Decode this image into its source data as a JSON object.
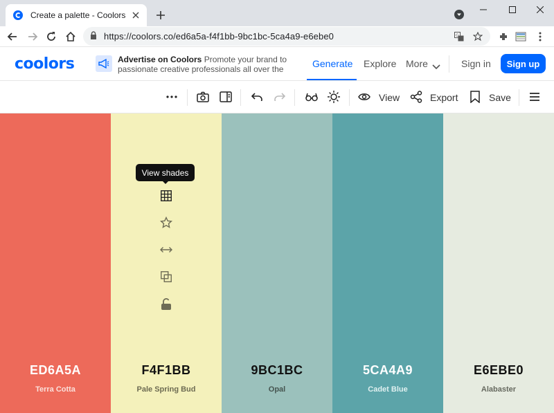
{
  "browser": {
    "tab_title": "Create a palette - Coolors",
    "url_host": "https://coolors.co",
    "url_path": "/ed6a5a-f4f1bb-9bc1bc-5ca4a9-e6ebe0"
  },
  "header": {
    "logo": "coolors",
    "ad_title": "Advertise on Coolors",
    "ad_body": "Promote your brand to passionate creative professionals all over the",
    "nav": [
      "Generate",
      "Explore",
      "More"
    ],
    "signin": "Sign in",
    "signup": "Sign up"
  },
  "toolbar": {
    "view_label": "View",
    "export_label": "Export",
    "save_label": "Save"
  },
  "tooltip": "View shades",
  "colors": [
    {
      "hex": "ED6A5A",
      "name": "Terra Cotta",
      "bg": "#ed6a5a",
      "text": "#ffffff",
      "sub": "#fbe0db"
    },
    {
      "hex": "F4F1BB",
      "name": "Pale Spring Bud",
      "bg": "#f4f1bb",
      "text": "#111111",
      "sub": "#6d6b52"
    },
    {
      "hex": "9BC1BC",
      "name": "Opal",
      "bg": "#9bc1bc",
      "text": "#111111",
      "sub": "#45544f"
    },
    {
      "hex": "5CA4A9",
      "name": "Cadet Blue",
      "bg": "#5ca4a9",
      "text": "#ffffff",
      "sub": "#dff0f0"
    },
    {
      "hex": "E6EBE0",
      "name": "Alabaster",
      "bg": "#e6ebe0",
      "text": "#111111",
      "sub": "#66695f"
    }
  ]
}
